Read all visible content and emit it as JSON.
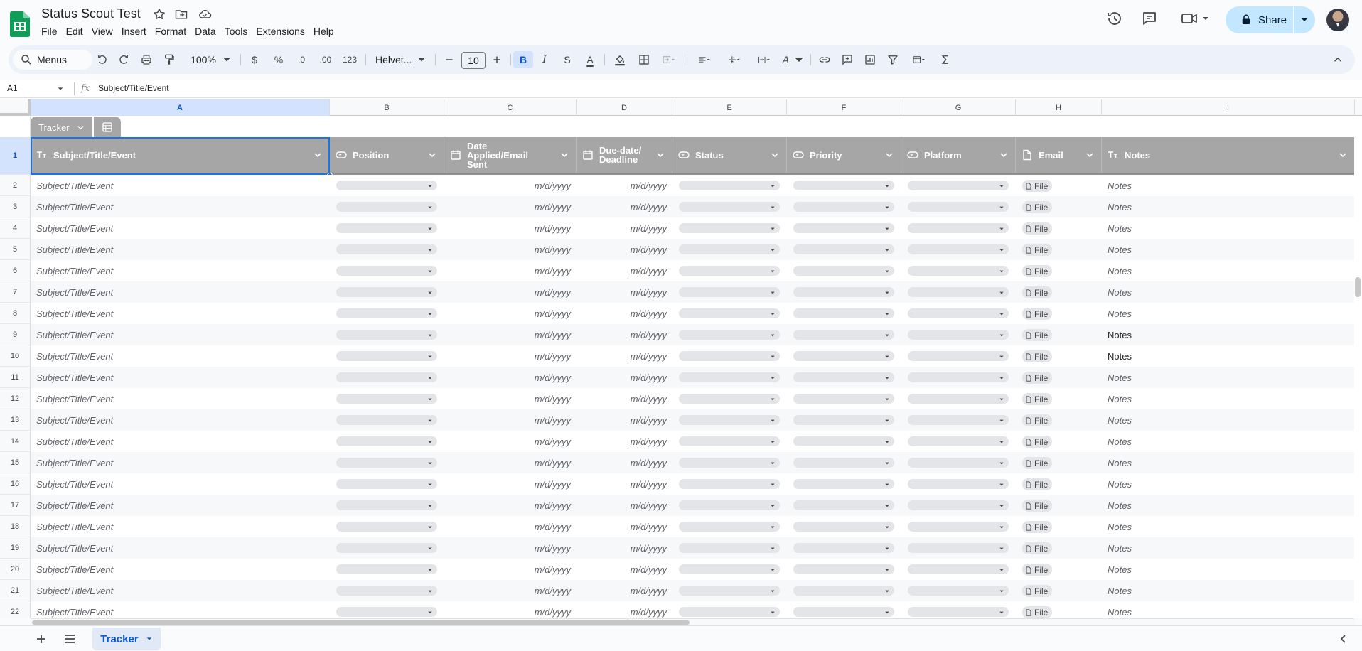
{
  "app": {
    "doc_title": "Status Scout Test",
    "menus": [
      "File",
      "Edit",
      "View",
      "Insert",
      "Format",
      "Data",
      "Tools",
      "Extensions",
      "Help"
    ],
    "share_label": "Share"
  },
  "toolbar": {
    "search_label": "Menus",
    "zoom": "100%",
    "currency": "$",
    "percent": "%",
    "dec_decrease": ".0",
    "dec_increase": ".00",
    "number_format": "123",
    "font_name": "Helvet...",
    "font_size": "10",
    "bold": "B",
    "italic": "I",
    "strike": "S",
    "text_color": "A",
    "text_rotation": "A"
  },
  "formula_bar": {
    "name_box": "A1",
    "fx": "fx",
    "value": "Subject/Title/Event"
  },
  "grid": {
    "columns": [
      "A",
      "B",
      "C",
      "D",
      "E",
      "F",
      "G",
      "H",
      "I"
    ],
    "rows": [
      "1",
      "2",
      "3",
      "4",
      "5",
      "6",
      "7",
      "8",
      "9",
      "10",
      "11",
      "12",
      "13",
      "14",
      "15",
      "16",
      "17",
      "18",
      "19",
      "20",
      "21",
      "22"
    ]
  },
  "table": {
    "name": "Tracker",
    "headers": [
      {
        "label": "Subject/Title/Event",
        "type": "text"
      },
      {
        "label": "Position",
        "type": "dropdown"
      },
      {
        "label": "Date Applied/Email Sent",
        "type": "date"
      },
      {
        "label": "Due-date/ Deadline",
        "type": "date"
      },
      {
        "label": "Status",
        "type": "dropdown"
      },
      {
        "label": "Priority",
        "type": "dropdown"
      },
      {
        "label": "Platform",
        "type": "dropdown"
      },
      {
        "label": "Email",
        "type": "file"
      },
      {
        "label": "Notes",
        "type": "text"
      }
    ],
    "placeholders": {
      "subject": "Subject/Title/Event",
      "date": "m/d/yyyy",
      "file": "File",
      "notes": "Notes"
    },
    "plain_notes_rows": [
      "9",
      "10"
    ]
  },
  "sheets": {
    "tabs": [
      {
        "label": "Tracker",
        "active": true
      }
    ]
  },
  "colors": {
    "accent": "#0b57d0",
    "table_header": "#a6a6a6",
    "share_bg": "#c2e7ff",
    "sheets_green": "#0f9d58"
  }
}
